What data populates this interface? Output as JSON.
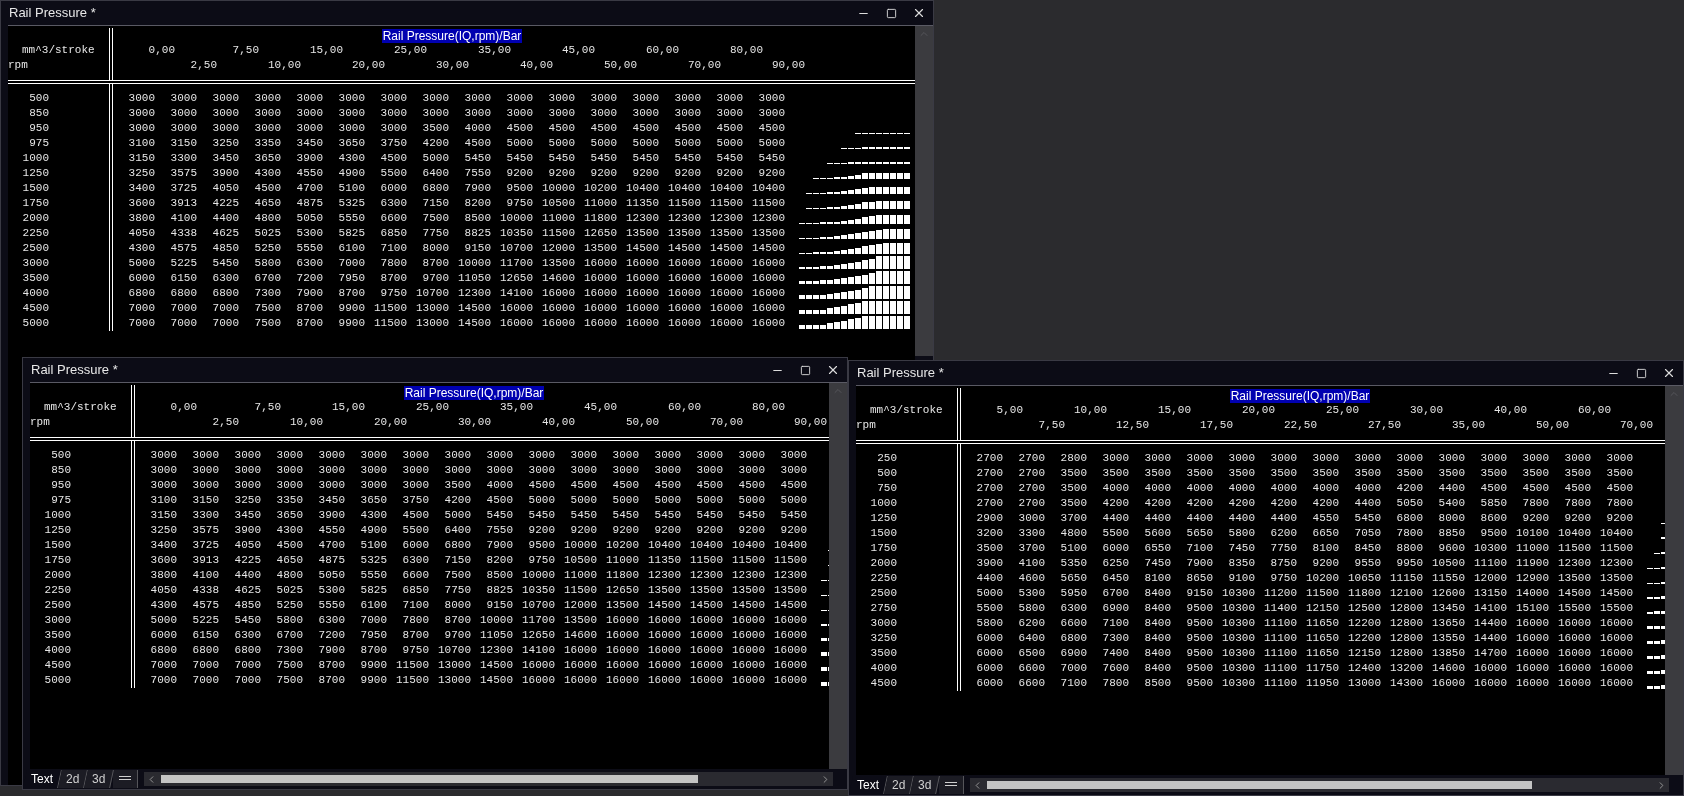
{
  "windows": [
    {
      "title": "Rail Pressure *",
      "map_title": "Rail Pressure(IQ,rpm)/Bar",
      "x_axis_label": "mm^3/stroke",
      "y_axis_label": "rpm",
      "x_breakpoints": [
        "0,00",
        "2,50",
        "7,50",
        "10,00",
        "15,00",
        "20,00",
        "25,00",
        "30,00",
        "35,00",
        "40,00",
        "45,00",
        "50,00",
        "60,00",
        "70,00",
        "80,00",
        "90,00"
      ],
      "rows": [
        {
          "rpm": "500",
          "values": [
            "3000",
            "3000",
            "3000",
            "3000",
            "3000",
            "3000",
            "3000",
            "3000",
            "3000",
            "3000",
            "3000",
            "3000",
            "3000",
            "3000",
            "3000",
            "3000"
          ]
        },
        {
          "rpm": "850",
          "values": [
            "3000",
            "3000",
            "3000",
            "3000",
            "3000",
            "3000",
            "3000",
            "3000",
            "3000",
            "3000",
            "3000",
            "3000",
            "3000",
            "3000",
            "3000",
            "3000"
          ]
        },
        {
          "rpm": "950",
          "values": [
            "3000",
            "3000",
            "3000",
            "3000",
            "3000",
            "3000",
            "3000",
            "3500",
            "4000",
            "4500",
            "4500",
            "4500",
            "4500",
            "4500",
            "4500",
            "4500"
          ]
        },
        {
          "rpm": "975",
          "values": [
            "3100",
            "3150",
            "3250",
            "3350",
            "3450",
            "3650",
            "3750",
            "4200",
            "4500",
            "5000",
            "5000",
            "5000",
            "5000",
            "5000",
            "5000",
            "5000"
          ]
        },
        {
          "rpm": "1000",
          "values": [
            "3150",
            "3300",
            "3450",
            "3650",
            "3900",
            "4300",
            "4500",
            "5000",
            "5450",
            "5450",
            "5450",
            "5450",
            "5450",
            "5450",
            "5450",
            "5450"
          ]
        },
        {
          "rpm": "1250",
          "values": [
            "3250",
            "3575",
            "3900",
            "4300",
            "4550",
            "4900",
            "5500",
            "6400",
            "7550",
            "9200",
            "9200",
            "9200",
            "9200",
            "9200",
            "9200",
            "9200"
          ]
        },
        {
          "rpm": "1500",
          "values": [
            "3400",
            "3725",
            "4050",
            "4500",
            "4700",
            "5100",
            "6000",
            "6800",
            "7900",
            "9500",
            "10000",
            "10200",
            "10400",
            "10400",
            "10400",
            "10400"
          ]
        },
        {
          "rpm": "1750",
          "values": [
            "3600",
            "3913",
            "4225",
            "4650",
            "4875",
            "5325",
            "6300",
            "7150",
            "8200",
            "9750",
            "10500",
            "11000",
            "11350",
            "11500",
            "11500",
            "11500"
          ]
        },
        {
          "rpm": "2000",
          "values": [
            "3800",
            "4100",
            "4400",
            "4800",
            "5050",
            "5550",
            "6600",
            "7500",
            "8500",
            "10000",
            "11000",
            "11800",
            "12300",
            "12300",
            "12300",
            "12300"
          ]
        },
        {
          "rpm": "2250",
          "values": [
            "4050",
            "4338",
            "4625",
            "5025",
            "5300",
            "5825",
            "6850",
            "7750",
            "8825",
            "10350",
            "11500",
            "12650",
            "13500",
            "13500",
            "13500",
            "13500"
          ]
        },
        {
          "rpm": "2500",
          "values": [
            "4300",
            "4575",
            "4850",
            "5250",
            "5550",
            "6100",
            "7100",
            "8000",
            "9150",
            "10700",
            "12000",
            "13500",
            "14500",
            "14500",
            "14500",
            "14500"
          ]
        },
        {
          "rpm": "3000",
          "values": [
            "5000",
            "5225",
            "5450",
            "5800",
            "6300",
            "7000",
            "7800",
            "8700",
            "10000",
            "11700",
            "13500",
            "16000",
            "16000",
            "16000",
            "16000",
            "16000"
          ]
        },
        {
          "rpm": "3500",
          "values": [
            "6000",
            "6150",
            "6300",
            "6700",
            "7200",
            "7950",
            "8700",
            "9700",
            "11050",
            "12650",
            "14600",
            "16000",
            "16000",
            "16000",
            "16000",
            "16000"
          ]
        },
        {
          "rpm": "4000",
          "values": [
            "6800",
            "6800",
            "6800",
            "7300",
            "7900",
            "8700",
            "9750",
            "10700",
            "12300",
            "14100",
            "16000",
            "16000",
            "16000",
            "16000",
            "16000",
            "16000"
          ]
        },
        {
          "rpm": "4500",
          "values": [
            "7000",
            "7000",
            "7000",
            "7500",
            "8700",
            "9900",
            "11500",
            "13000",
            "14500",
            "16000",
            "16000",
            "16000",
            "16000",
            "16000",
            "16000",
            "16000"
          ]
        },
        {
          "rpm": "5000",
          "values": [
            "7000",
            "7000",
            "7000",
            "7500",
            "8700",
            "9900",
            "11500",
            "13000",
            "14500",
            "16000",
            "16000",
            "16000",
            "16000",
            "16000",
            "16000",
            "16000"
          ]
        }
      ]
    },
    {
      "title": "Rail Pressure *",
      "map_title": "Rail Pressure(IQ,rpm)/Bar",
      "x_axis_label": "mm^3/stroke",
      "y_axis_label": "rpm",
      "x_breakpoints": [
        "0,00",
        "2,50",
        "7,50",
        "10,00",
        "15,00",
        "20,00",
        "25,00",
        "30,00",
        "35,00",
        "40,00",
        "45,00",
        "50,00",
        "60,00",
        "70,00",
        "80,00",
        "90,00"
      ],
      "rows": [
        {
          "rpm": "500",
          "values": [
            "3000",
            "3000",
            "3000",
            "3000",
            "3000",
            "3000",
            "3000",
            "3000",
            "3000",
            "3000",
            "3000",
            "3000",
            "3000",
            "3000",
            "3000",
            "3000"
          ]
        },
        {
          "rpm": "850",
          "values": [
            "3000",
            "3000",
            "3000",
            "3000",
            "3000",
            "3000",
            "3000",
            "3000",
            "3000",
            "3000",
            "3000",
            "3000",
            "3000",
            "3000",
            "3000",
            "3000"
          ]
        },
        {
          "rpm": "950",
          "values": [
            "3000",
            "3000",
            "3000",
            "3000",
            "3000",
            "3000",
            "3000",
            "3500",
            "4000",
            "4500",
            "4500",
            "4500",
            "4500",
            "4500",
            "4500",
            "4500"
          ]
        },
        {
          "rpm": "975",
          "values": [
            "3100",
            "3150",
            "3250",
            "3350",
            "3450",
            "3650",
            "3750",
            "4200",
            "4500",
            "5000",
            "5000",
            "5000",
            "5000",
            "5000",
            "5000",
            "5000"
          ]
        },
        {
          "rpm": "1000",
          "values": [
            "3150",
            "3300",
            "3450",
            "3650",
            "3900",
            "4300",
            "4500",
            "5000",
            "5450",
            "5450",
            "5450",
            "5450",
            "5450",
            "5450",
            "5450",
            "5450"
          ]
        },
        {
          "rpm": "1250",
          "values": [
            "3250",
            "3575",
            "3900",
            "4300",
            "4550",
            "4900",
            "5500",
            "6400",
            "7550",
            "9200",
            "9200",
            "9200",
            "9200",
            "9200",
            "9200",
            "9200"
          ]
        },
        {
          "rpm": "1500",
          "values": [
            "3400",
            "3725",
            "4050",
            "4500",
            "4700",
            "5100",
            "6000",
            "6800",
            "7900",
            "9500",
            "10000",
            "10200",
            "10400",
            "10400",
            "10400",
            "10400"
          ]
        },
        {
          "rpm": "1750",
          "values": [
            "3600",
            "3913",
            "4225",
            "4650",
            "4875",
            "5325",
            "6300",
            "7150",
            "8200",
            "9750",
            "10500",
            "11000",
            "11350",
            "11500",
            "11500",
            "11500"
          ]
        },
        {
          "rpm": "2000",
          "values": [
            "3800",
            "4100",
            "4400",
            "4800",
            "5050",
            "5550",
            "6600",
            "7500",
            "8500",
            "10000",
            "11000",
            "11800",
            "12300",
            "12300",
            "12300",
            "12300"
          ]
        },
        {
          "rpm": "2250",
          "values": [
            "4050",
            "4338",
            "4625",
            "5025",
            "5300",
            "5825",
            "6850",
            "7750",
            "8825",
            "10350",
            "11500",
            "12650",
            "13500",
            "13500",
            "13500",
            "13500"
          ]
        },
        {
          "rpm": "2500",
          "values": [
            "4300",
            "4575",
            "4850",
            "5250",
            "5550",
            "6100",
            "7100",
            "8000",
            "9150",
            "10700",
            "12000",
            "13500",
            "14500",
            "14500",
            "14500",
            "14500"
          ]
        },
        {
          "rpm": "3000",
          "values": [
            "5000",
            "5225",
            "5450",
            "5800",
            "6300",
            "7000",
            "7800",
            "8700",
            "10000",
            "11700",
            "13500",
            "16000",
            "16000",
            "16000",
            "16000",
            "16000"
          ]
        },
        {
          "rpm": "3500",
          "values": [
            "6000",
            "6150",
            "6300",
            "6700",
            "7200",
            "7950",
            "8700",
            "9700",
            "11050",
            "12650",
            "14600",
            "16000",
            "16000",
            "16000",
            "16000",
            "16000"
          ]
        },
        {
          "rpm": "4000",
          "values": [
            "6800",
            "6800",
            "6800",
            "7300",
            "7900",
            "8700",
            "9750",
            "10700",
            "12300",
            "14100",
            "16000",
            "16000",
            "16000",
            "16000",
            "16000",
            "16000"
          ]
        },
        {
          "rpm": "4500",
          "values": [
            "7000",
            "7000",
            "7000",
            "7500",
            "8700",
            "9900",
            "11500",
            "13000",
            "14500",
            "16000",
            "16000",
            "16000",
            "16000",
            "16000",
            "16000",
            "16000"
          ]
        },
        {
          "rpm": "5000",
          "values": [
            "7000",
            "7000",
            "7000",
            "7500",
            "8700",
            "9900",
            "11500",
            "13000",
            "14500",
            "16000",
            "16000",
            "16000",
            "16000",
            "16000",
            "16000",
            "16000"
          ]
        }
      ],
      "view_tabs": [
        {
          "label": "Text",
          "selected": true
        },
        {
          "label": "2d",
          "selected": false
        },
        {
          "label": "3d",
          "selected": false
        }
      ]
    },
    {
      "title": "Rail Pressure *",
      "map_title": "Rail Pressure(IQ,rpm)/Bar",
      "x_axis_label": "mm^3/stroke",
      "y_axis_label": "rpm",
      "x_breakpoints": [
        "5,00",
        "7,50",
        "10,00",
        "12,50",
        "15,00",
        "17,50",
        "20,00",
        "22,50",
        "25,00",
        "27,50",
        "30,00",
        "35,00",
        "40,00",
        "50,00",
        "60,00",
        "70,00"
      ],
      "rows": [
        {
          "rpm": "250",
          "values": [
            "2700",
            "2700",
            "2800",
            "3000",
            "3000",
            "3000",
            "3000",
            "3000",
            "3000",
            "3000",
            "3000",
            "3000",
            "3000",
            "3000",
            "3000",
            "3000"
          ]
        },
        {
          "rpm": "500",
          "values": [
            "2700",
            "2700",
            "3500",
            "3500",
            "3500",
            "3500",
            "3500",
            "3500",
            "3500",
            "3500",
            "3500",
            "3500",
            "3500",
            "3500",
            "3500",
            "3500"
          ]
        },
        {
          "rpm": "750",
          "values": [
            "2700",
            "2700",
            "3500",
            "4000",
            "4000",
            "4000",
            "4000",
            "4000",
            "4000",
            "4000",
            "4200",
            "4400",
            "4500",
            "4500",
            "4500",
            "4500"
          ]
        },
        {
          "rpm": "1000",
          "values": [
            "2700",
            "2700",
            "3500",
            "4200",
            "4200",
            "4200",
            "4200",
            "4200",
            "4200",
            "4400",
            "5050",
            "5400",
            "5850",
            "7800",
            "7800",
            "7800"
          ]
        },
        {
          "rpm": "1250",
          "values": [
            "2900",
            "3000",
            "3700",
            "4400",
            "4400",
            "4400",
            "4400",
            "4400",
            "4550",
            "5450",
            "6800",
            "8000",
            "8600",
            "9200",
            "9200",
            "9200"
          ]
        },
        {
          "rpm": "1500",
          "values": [
            "3200",
            "3300",
            "4800",
            "5500",
            "5600",
            "5650",
            "5800",
            "6200",
            "6650",
            "7050",
            "7800",
            "8850",
            "9500",
            "10100",
            "10400",
            "10400"
          ]
        },
        {
          "rpm": "1750",
          "values": [
            "3500",
            "3700",
            "5100",
            "6000",
            "6550",
            "7100",
            "7450",
            "7750",
            "8100",
            "8450",
            "8800",
            "9600",
            "10300",
            "11000",
            "11500",
            "11500"
          ]
        },
        {
          "rpm": "2000",
          "values": [
            "3900",
            "4100",
            "5350",
            "6250",
            "7450",
            "7900",
            "8350",
            "8750",
            "9200",
            "9550",
            "9950",
            "10500",
            "11100",
            "11900",
            "12300",
            "12300"
          ]
        },
        {
          "rpm": "2250",
          "values": [
            "4400",
            "4600",
            "5650",
            "6450",
            "8100",
            "8650",
            "9100",
            "9750",
            "10200",
            "10650",
            "11150",
            "11550",
            "12000",
            "12900",
            "13500",
            "13500"
          ]
        },
        {
          "rpm": "2500",
          "values": [
            "5000",
            "5300",
            "5950",
            "6700",
            "8400",
            "9150",
            "10300",
            "11200",
            "11500",
            "11800",
            "12100",
            "12600",
            "13150",
            "14000",
            "14500",
            "14500"
          ]
        },
        {
          "rpm": "2750",
          "values": [
            "5500",
            "5800",
            "6300",
            "6900",
            "8400",
            "9500",
            "10300",
            "11400",
            "12150",
            "12500",
            "12800",
            "13450",
            "14100",
            "15100",
            "15500",
            "15500"
          ]
        },
        {
          "rpm": "3000",
          "values": [
            "5800",
            "6200",
            "6600",
            "7100",
            "8400",
            "9500",
            "10300",
            "11100",
            "11650",
            "12200",
            "12800",
            "13650",
            "14400",
            "16000",
            "16000",
            "16000"
          ]
        },
        {
          "rpm": "3250",
          "values": [
            "6000",
            "6400",
            "6800",
            "7300",
            "8400",
            "9500",
            "10300",
            "11100",
            "11650",
            "12200",
            "12800",
            "13550",
            "14400",
            "16000",
            "16000",
            "16000"
          ]
        },
        {
          "rpm": "3500",
          "values": [
            "6000",
            "6500",
            "6900",
            "7400",
            "8400",
            "9500",
            "10300",
            "11100",
            "11650",
            "12150",
            "12800",
            "13850",
            "14700",
            "16000",
            "16000",
            "16000"
          ]
        },
        {
          "rpm": "4000",
          "values": [
            "6000",
            "6600",
            "7000",
            "7600",
            "8400",
            "9500",
            "10300",
            "11100",
            "11750",
            "12400",
            "13200",
            "14600",
            "16000",
            "16000",
            "16000",
            "16000"
          ]
        },
        {
          "rpm": "4500",
          "values": [
            "6000",
            "6600",
            "7100",
            "7800",
            "8500",
            "9500",
            "10300",
            "11100",
            "11950",
            "13000",
            "14300",
            "16000",
            "16000",
            "16000",
            "16000",
            "16000"
          ]
        }
      ],
      "view_tabs": [
        {
          "label": "Text",
          "selected": true
        },
        {
          "label": "2d",
          "selected": false
        },
        {
          "label": "3d",
          "selected": false
        }
      ]
    }
  ]
}
